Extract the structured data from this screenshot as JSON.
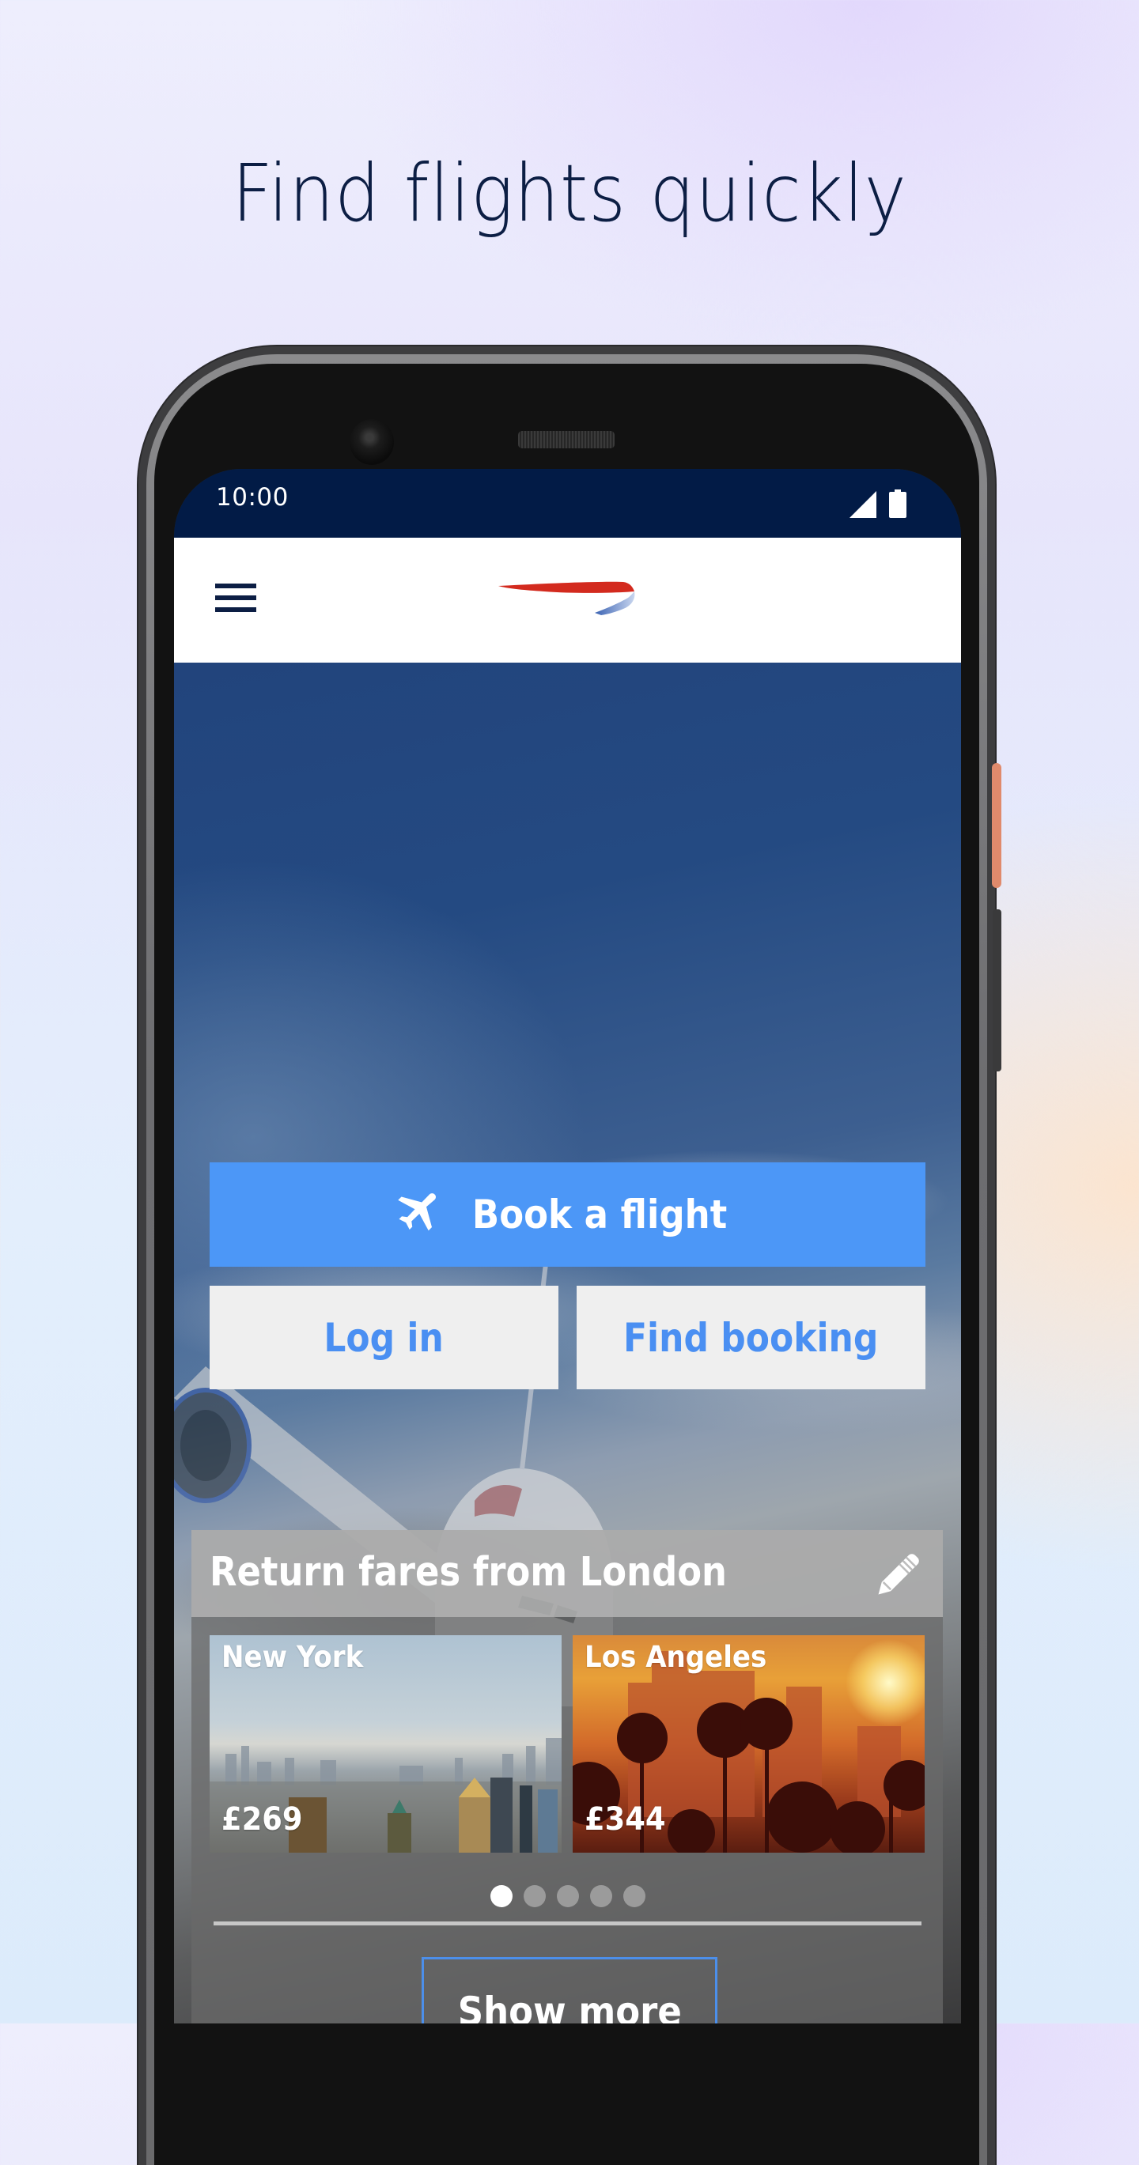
{
  "promo": {
    "headline": "Find flights quickly"
  },
  "status_bar": {
    "time": "10:00",
    "icons": [
      "signal-icon",
      "battery-icon"
    ]
  },
  "app_bar": {
    "menu_icon": "hamburger-menu-icon",
    "logo": "british-airways-speedmarque-logo"
  },
  "actions": {
    "book_flight": {
      "label": "Book a flight",
      "icon": "airplane-icon"
    },
    "log_in": {
      "label": "Log in"
    },
    "find_booking": {
      "label": "Find booking"
    }
  },
  "fares": {
    "title": "Return fares from London",
    "edit_icon": "pencil-icon",
    "cards": [
      {
        "city": "New York",
        "price": "£269"
      },
      {
        "city": "Los Angeles",
        "price": "£344"
      }
    ],
    "pagination": {
      "total": 5,
      "active_index": 0
    },
    "show_more_label": "Show more"
  },
  "colors": {
    "navy": "#021b46",
    "primary_blue": "#4c97f7",
    "link_blue": "#4a8ff2",
    "ba_red": "#d22a1e",
    "ba_blue": "#3f6ab8",
    "side_button_accent": "#e08a6c"
  }
}
